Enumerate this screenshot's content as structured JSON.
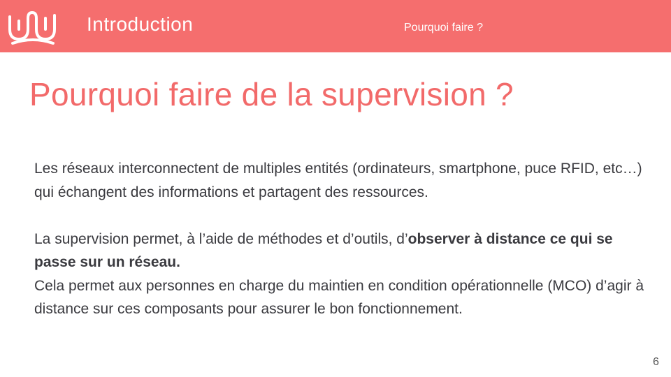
{
  "header": {
    "section_title": "Introduction",
    "section_subtitle": "Pourquoi faire ?",
    "logo_icon": "wave-logo-icon",
    "background_color": "#f56e6e"
  },
  "title": "Pourquoi faire de la supervision ?",
  "title_color": "#f26a6a",
  "paragraph1": "Les réseaux interconnectent de multiples entités (ordinateurs, smartphone, puce RFID, etc…) qui échangent des informations et partagent des ressources.",
  "paragraph2": {
    "prefix": "La supervision permet, à l’aide de méthodes et d’outils, d’",
    "bold": "observer à distance ce qui se passe sur un réseau."
  },
  "paragraph3": "Cela permet aux personnes en charge du maintien en condition opérationnelle (MCO) d’agir à distance sur ces composants pour assurer le bon fonctionnement.",
  "page_number": "6"
}
